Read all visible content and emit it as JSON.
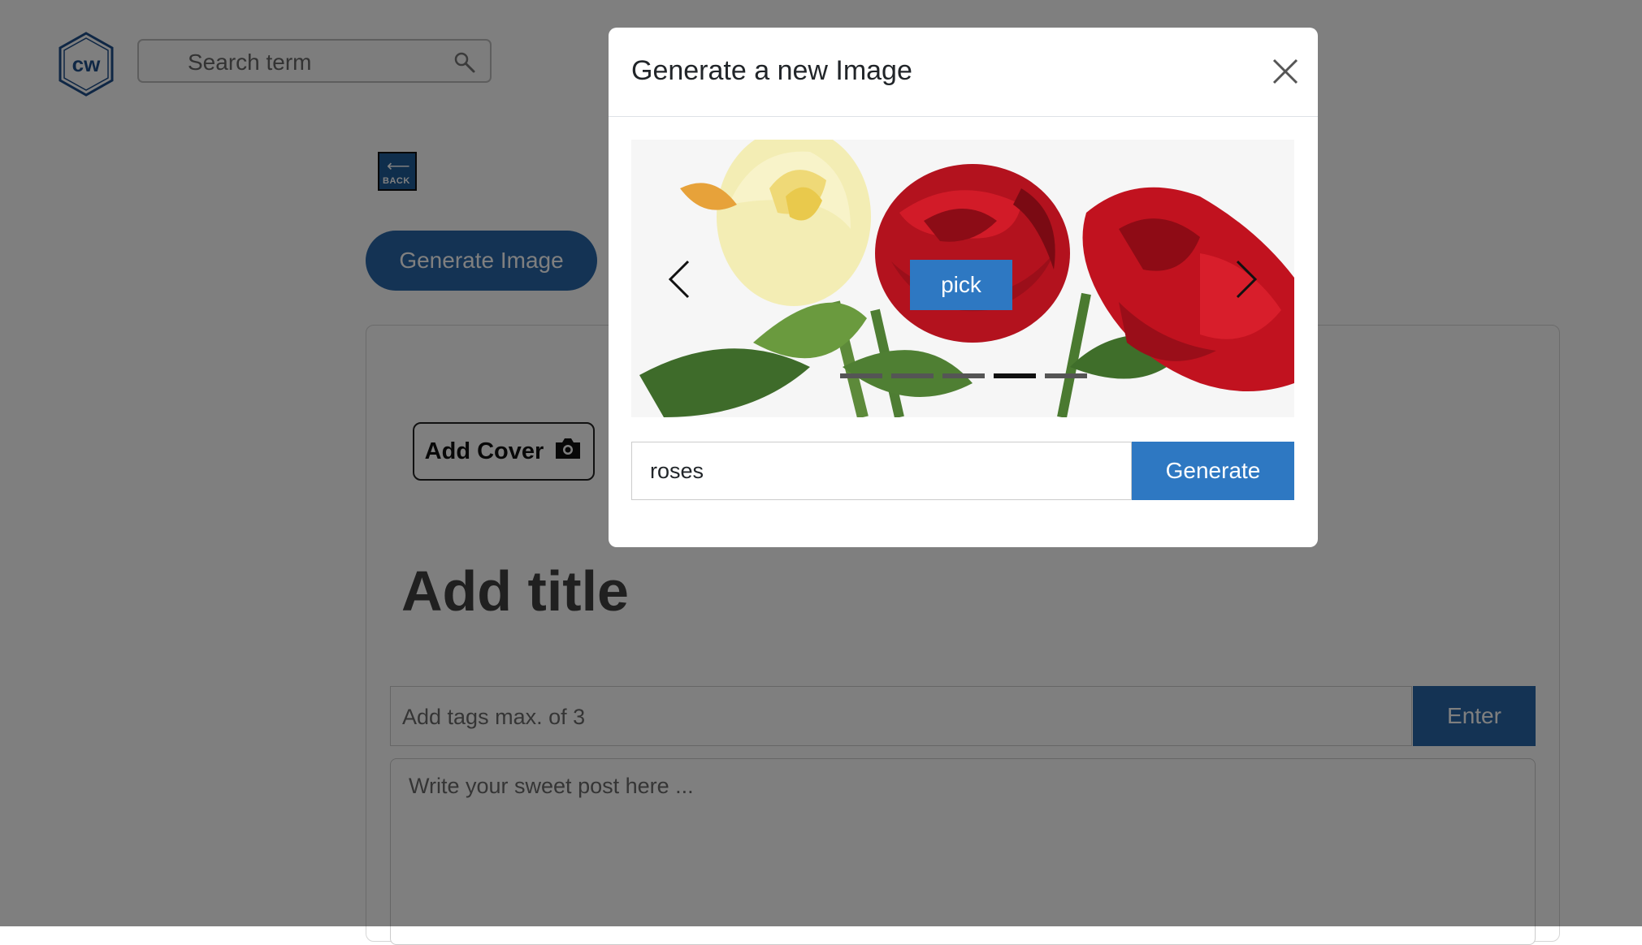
{
  "header": {
    "logo_text": "cw",
    "search_placeholder": "Search term"
  },
  "editor": {
    "back_label": "BACK",
    "generate_image_label": "Generate Image",
    "add_cover_label": "Add Cover",
    "title_placeholder": "Add title",
    "tags_placeholder": "Add tags max. of 3",
    "enter_label": "Enter",
    "post_placeholder": "Write your sweet post here ..."
  },
  "modal": {
    "title": "Generate a new Image",
    "pick_label": "pick",
    "prompt_value": "roses",
    "generate_label": "Generate",
    "carousel": {
      "slide_count": 5,
      "active_index": 3
    }
  },
  "colors": {
    "primary": "#2867a8",
    "modal_primary": "#2e78c2",
    "backdrop": "rgba(0,0,0,0.5)"
  },
  "icons": {
    "search": "search-icon",
    "camera": "camera-icon",
    "close": "close-icon",
    "prev": "chevron-left-icon",
    "next": "chevron-right-icon",
    "back_arrow": "arrow-left-icon"
  }
}
